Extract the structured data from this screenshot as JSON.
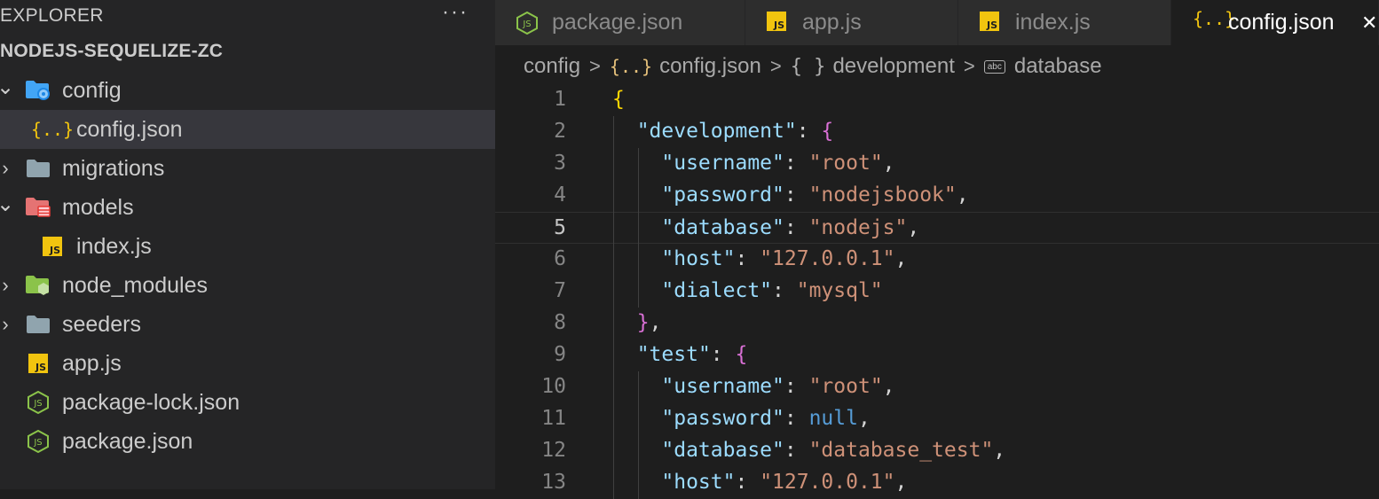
{
  "sidebar": {
    "title": "EXPLORER",
    "more_icon": "ellipsis-icon",
    "project_name": "NODEJS-SEQUELIZE-ZC",
    "tree": [
      {
        "label": "config",
        "type": "folder",
        "expanded": true,
        "icon": "config-folder-icon",
        "depth": 0
      },
      {
        "label": "config.json",
        "type": "file",
        "icon": "json-braces-icon",
        "depth": 1,
        "selected": true
      },
      {
        "label": "migrations",
        "type": "folder",
        "expanded": false,
        "icon": "folder-icon",
        "depth": 0
      },
      {
        "label": "models",
        "type": "folder",
        "expanded": true,
        "icon": "models-folder-icon",
        "depth": 0
      },
      {
        "label": "index.js",
        "type": "file",
        "icon": "js-file-icon",
        "depth": 1
      },
      {
        "label": "node_modules",
        "type": "folder",
        "expanded": false,
        "icon": "node-folder-icon",
        "depth": 0
      },
      {
        "label": "seeders",
        "type": "folder",
        "expanded": false,
        "icon": "folder-icon",
        "depth": 0
      },
      {
        "label": "app.js",
        "type": "file",
        "icon": "js-file-icon",
        "depth": 0
      },
      {
        "label": "package-lock.json",
        "type": "file",
        "icon": "node-json-icon",
        "depth": 0
      },
      {
        "label": "package.json",
        "type": "file",
        "icon": "node-json-icon",
        "depth": 0
      }
    ]
  },
  "tabs": [
    {
      "label": "package.json",
      "icon": "node-json-icon",
      "active": false
    },
    {
      "label": "app.js",
      "icon": "js-file-icon",
      "active": false
    },
    {
      "label": "index.js",
      "icon": "js-file-icon",
      "active": false
    },
    {
      "label": "config.json",
      "icon": "json-braces-icon",
      "active": true
    }
  ],
  "breadcrumb": {
    "folder": "config",
    "file": "config.json",
    "object": "development",
    "field": "database",
    "file_icon_text": "{..}",
    "object_icon_text": "{ }",
    "field_icon_text": "abc"
  },
  "editor": {
    "current_line": 5,
    "lines": [
      {
        "n": "1",
        "tokens": [
          [
            "b1",
            "{"
          ]
        ]
      },
      {
        "n": "2",
        "tokens": [
          [
            "p",
            "  "
          ],
          [
            "key",
            "\"development\""
          ],
          [
            "p",
            ": "
          ],
          [
            "b2",
            "{"
          ]
        ]
      },
      {
        "n": "3",
        "tokens": [
          [
            "p",
            "    "
          ],
          [
            "key",
            "\"username\""
          ],
          [
            "p",
            ": "
          ],
          [
            "str",
            "\"root\""
          ],
          [
            "p",
            ","
          ]
        ]
      },
      {
        "n": "4",
        "tokens": [
          [
            "p",
            "    "
          ],
          [
            "key",
            "\"password\""
          ],
          [
            "p",
            ": "
          ],
          [
            "str",
            "\"nodejsbook\""
          ],
          [
            "p",
            ","
          ]
        ]
      },
      {
        "n": "5",
        "tokens": [
          [
            "p",
            "    "
          ],
          [
            "key",
            "\"database\""
          ],
          [
            "p",
            ": "
          ],
          [
            "str",
            "\"nodejs\""
          ],
          [
            "p",
            ","
          ]
        ]
      },
      {
        "n": "6",
        "tokens": [
          [
            "p",
            "    "
          ],
          [
            "key",
            "\"host\""
          ],
          [
            "p",
            ": "
          ],
          [
            "str",
            "\"127.0.0.1\""
          ],
          [
            "p",
            ","
          ]
        ]
      },
      {
        "n": "7",
        "tokens": [
          [
            "p",
            "    "
          ],
          [
            "key",
            "\"dialect\""
          ],
          [
            "p",
            ": "
          ],
          [
            "str",
            "\"mysql\""
          ]
        ]
      },
      {
        "n": "8",
        "tokens": [
          [
            "p",
            "  "
          ],
          [
            "b2",
            "}"
          ],
          [
            "p",
            ","
          ]
        ]
      },
      {
        "n": "9",
        "tokens": [
          [
            "p",
            "  "
          ],
          [
            "key",
            "\"test\""
          ],
          [
            "p",
            ": "
          ],
          [
            "b2",
            "{"
          ]
        ]
      },
      {
        "n": "10",
        "tokens": [
          [
            "p",
            "    "
          ],
          [
            "key",
            "\"username\""
          ],
          [
            "p",
            ": "
          ],
          [
            "str",
            "\"root\""
          ],
          [
            "p",
            ","
          ]
        ]
      },
      {
        "n": "11",
        "tokens": [
          [
            "p",
            "    "
          ],
          [
            "key",
            "\"password\""
          ],
          [
            "p",
            ": "
          ],
          [
            "null",
            "null"
          ],
          [
            "p",
            ","
          ]
        ]
      },
      {
        "n": "12",
        "tokens": [
          [
            "p",
            "    "
          ],
          [
            "key",
            "\"database\""
          ],
          [
            "p",
            ": "
          ],
          [
            "str",
            "\"database_test\""
          ],
          [
            "p",
            ","
          ]
        ]
      },
      {
        "n": "13",
        "tokens": [
          [
            "p",
            "    "
          ],
          [
            "key",
            "\"host\""
          ],
          [
            "p",
            ": "
          ],
          [
            "str",
            "\"127.0.0.1\""
          ],
          [
            "p",
            ","
          ]
        ]
      }
    ]
  },
  "colors": {
    "sidebar_bg": "#252526",
    "editor_bg": "#1e1e1e",
    "selected_row": "#37373d",
    "json_key": "#9cdcfe",
    "json_string": "#ce9178",
    "json_null": "#569cd6",
    "js_icon": "#f1c40f",
    "node_icon": "#8bc34a"
  }
}
